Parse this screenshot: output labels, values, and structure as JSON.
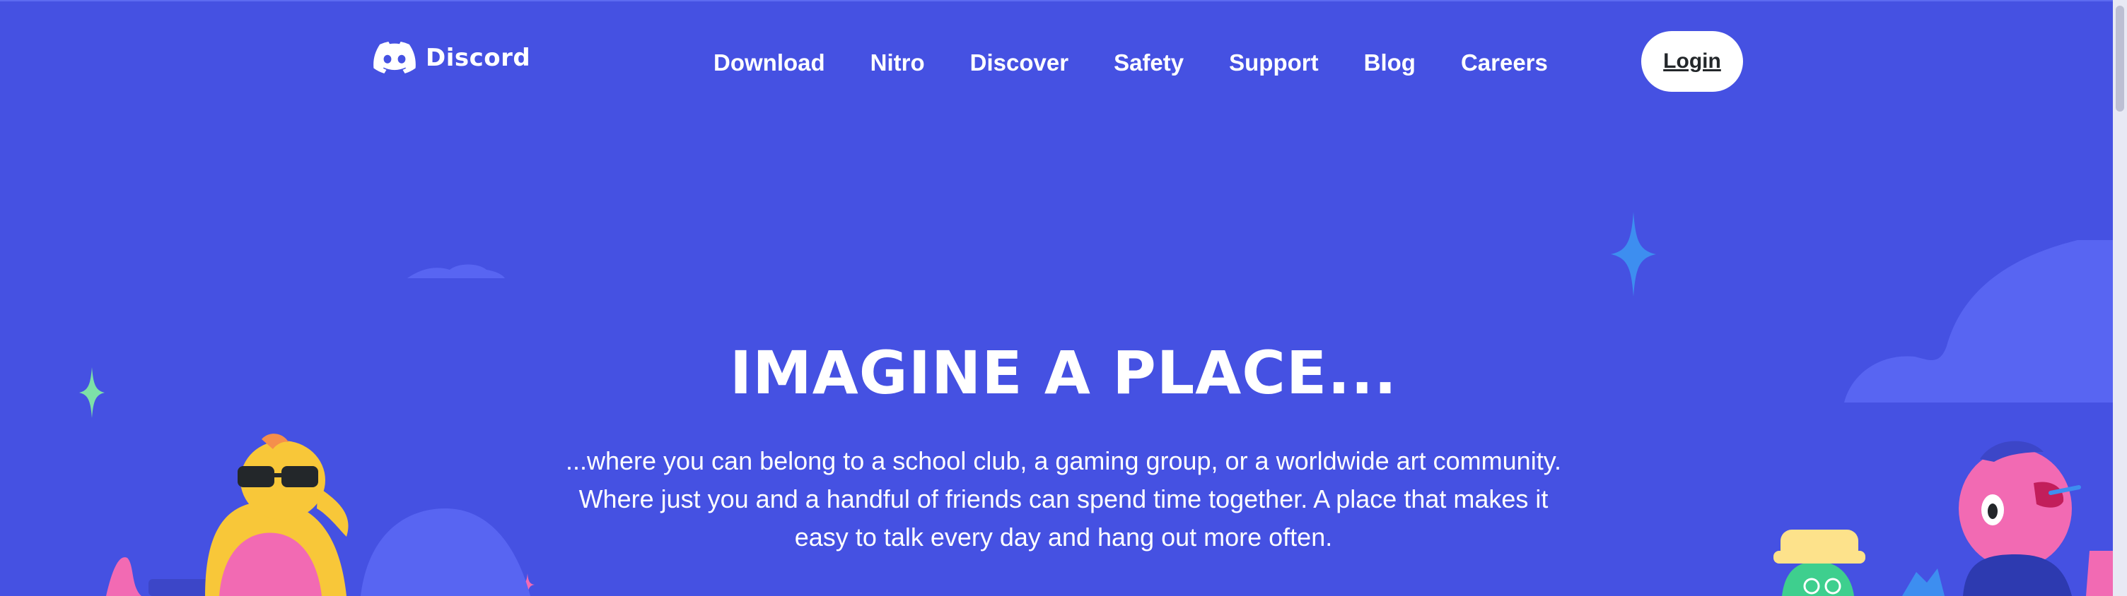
{
  "brand": {
    "name": "Discord",
    "logo_icon": "discord-logo-icon"
  },
  "nav": {
    "items": [
      {
        "label": "Download"
      },
      {
        "label": "Nitro"
      },
      {
        "label": "Discover"
      },
      {
        "label": "Safety"
      },
      {
        "label": "Support"
      },
      {
        "label": "Blog"
      },
      {
        "label": "Careers"
      }
    ],
    "login_label": "Login"
  },
  "hero": {
    "title": "IMAGINE A PLACE...",
    "body_line1": "...where you can belong to a school club, a gaming group, or a worldwide art community.",
    "body_line2": "Where just you and a handful of friends can spend time together. A place that makes it",
    "body_line3": "easy to talk every day and hang out more often."
  },
  "colors": {
    "background": "#4551e2",
    "login_bg": "#ffffff",
    "sparkle_green": "#7de0a8",
    "sparkle_blue": "#3d8ef0",
    "character_pink": "#f26ab3",
    "character_yellow": "#f8c739"
  }
}
